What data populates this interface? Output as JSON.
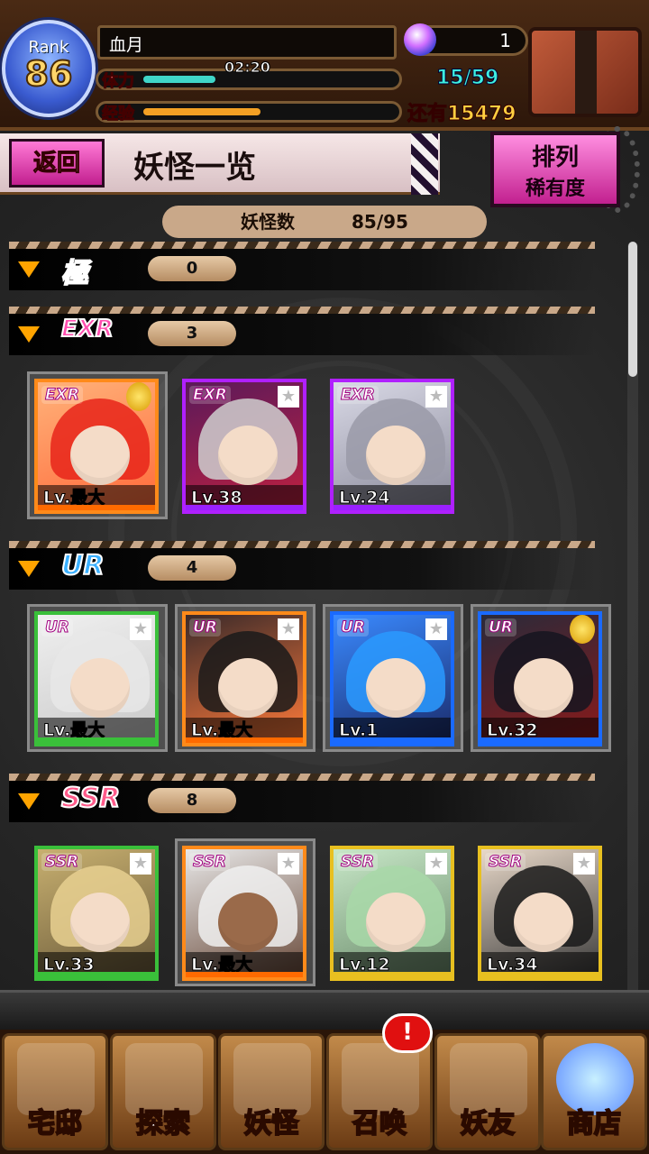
{
  "header": {
    "rank_label": "Rank",
    "rank_value": "86",
    "player_name": "血月",
    "hp_label": "体力",
    "hp_timer": "02:20",
    "exp_label": "经验",
    "orb_count": "1",
    "stamina": "15/59",
    "remaining": "还有15479"
  },
  "title": {
    "back": "返回",
    "page": "妖怪一览",
    "sort_line1": "排列",
    "sort_line2": "稀有度"
  },
  "count": {
    "label": "妖怪数",
    "value": "85/95"
  },
  "sections": [
    {
      "tier": "極",
      "count": "0"
    },
    {
      "tier": "EXR",
      "count": "3"
    },
    {
      "tier": "UR",
      "count": "4"
    },
    {
      "tier": "SSR",
      "count": "8"
    }
  ],
  "cards": {
    "exr": [
      {
        "badge": "EXR",
        "level": "Lv.最大"
      },
      {
        "badge": "EXR",
        "level": "Lv.38"
      },
      {
        "badge": "EXR",
        "level": "Lv.24"
      }
    ],
    "ur": [
      {
        "badge": "UR",
        "level": "Lv.最大"
      },
      {
        "badge": "UR",
        "level": "Lv.最大"
      },
      {
        "badge": "UR",
        "level": "Lv.1"
      },
      {
        "badge": "UR",
        "level": "Lv.32"
      }
    ],
    "ssr": [
      {
        "badge": "SSR",
        "level": "Lv.33"
      },
      {
        "badge": "SSR",
        "level": "Lv.最大"
      },
      {
        "badge": "SSR",
        "level": "Lv.12"
      },
      {
        "badge": "SSR",
        "level": "Lv.34"
      }
    ]
  },
  "nav": [
    {
      "label": "宅邸"
    },
    {
      "label": "探索"
    },
    {
      "label": "妖怪"
    },
    {
      "label": "召唤"
    },
    {
      "label": "妖友"
    },
    {
      "label": "商店"
    }
  ],
  "nav_alert": "!",
  "colors": {
    "accent": "#ff7ad6",
    "tier_gold": "#ffa400",
    "stamina": "#3ef0e0"
  }
}
